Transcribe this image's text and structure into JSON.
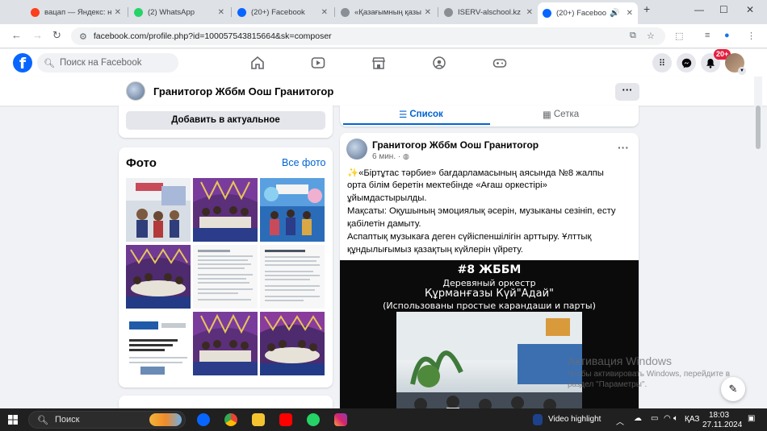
{
  "browser": {
    "tabs": [
      {
        "title": "вацап — Яндекс: нашлось",
        "color": "#fc3f1d"
      },
      {
        "title": "(2) WhatsApp",
        "color": "#25d366"
      },
      {
        "title": "(20+) Facebook",
        "color": "#0866ff"
      },
      {
        "title": "«Қазағымның қазына",
        "color": "#5f6368"
      },
      {
        "title": "ISERV-alschool.kz - Пл",
        "color": "#5f6368"
      },
      {
        "title": "(20+) Facebook",
        "color": "#0866ff"
      }
    ],
    "active_tab_index": 5,
    "url": "facebook.com/profile.php?id=100057543815664&sk=composer"
  },
  "facebook": {
    "search_placeholder": "Поиск на Facebook",
    "notification_count": "20+"
  },
  "profile": {
    "name": "Гранитогор Жббм Оош Гранитогор",
    "more_label": "···",
    "add_featured_label": "Добавить в актуальное"
  },
  "photos": {
    "title": "Фото",
    "see_all": "Все фото"
  },
  "view_tabs": {
    "list": "Список",
    "grid": "Сетка"
  },
  "post": {
    "author": "Гранитогор Жббм Оош Гранитогор",
    "time": "6 мин. ·",
    "lines": [
      "«Біртұтас тәрбие» бағдарламасының аясында   №8 жалпы",
      "орта білім беретін мектебінде «Ағаш оркестірі»",
      "ұйымдастырылды.",
      "Мақсаты: Оқушының эмоциялық әсерін, музыканы сезініп, есту",
      "қабілетін дамыту.",
      "Аспаптық музыкаға деген сүйіспеншілігін арттыру. Ұлттық",
      "құндылығымыз қазақтың күйлерін үйрету."
    ],
    "video": {
      "line1": "#8 ЖББМ",
      "line2": "Деревяный оркестр",
      "line3": "Құрманғазы Күй\"Адай\"",
      "line4": "(Использованы простые карандаши и парты)"
    }
  },
  "watermark": {
    "title": "Активация Windows",
    "text": "Чтобы активировать Windows, перейдите в раздел \"Параметры\"."
  },
  "taskbar": {
    "search": "Поиск",
    "video_highlight": "Video highlight",
    "lang": "ҚАЗ",
    "time": "18:03",
    "date": "27.11.2024"
  }
}
